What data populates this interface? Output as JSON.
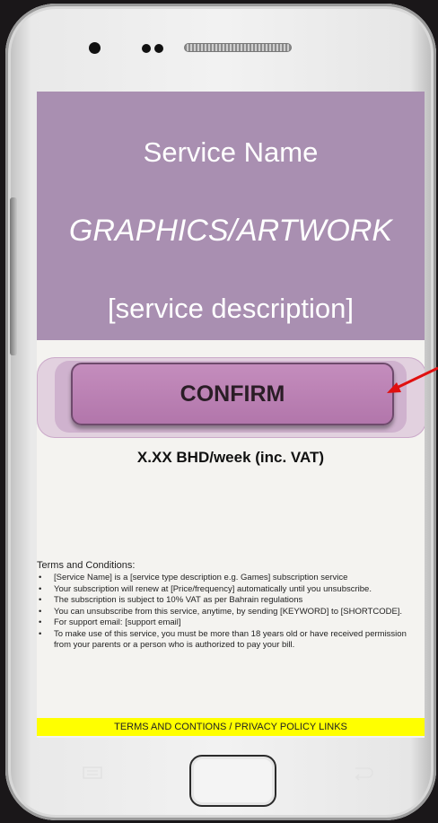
{
  "hero": {
    "service_name": "Service Name",
    "graphics": "GRAPHICS/ARTWORK",
    "description": "[service description]"
  },
  "cta": {
    "confirm_label": "CONFIRM",
    "price": "X.XX BHD/week (inc. VAT)"
  },
  "terms": {
    "title": "Terms and Conditions:",
    "items": [
      "[Service Name] is a [service type description e.g. Games] subscription service",
      "Your subscription will renew at [Price/frequency] automatically until you unsubscribe.",
      "The subscription is subject to 10% VAT as per Bahrain regulations",
      "You can unsubscribe from this service, anytime, by sending [KEYWORD] to [SHORTCODE].",
      "For support email: [support email]",
      "To make use of this service, you must be more than 18 years old or have received permission from your parents or a person who is authorized to pay your bill."
    ]
  },
  "footer": {
    "links": "TERMS AND CONTIONS / PRIVACY POLICY LINKS"
  },
  "colors": {
    "hero_bg": "#a98fb1",
    "confirm_bg": "#b97fb3",
    "footer_bg": "#ffff00",
    "arrow": "#e01010"
  },
  "icons": [
    "menu-icon",
    "back-icon",
    "red-arrow-icon",
    "home-button"
  ]
}
